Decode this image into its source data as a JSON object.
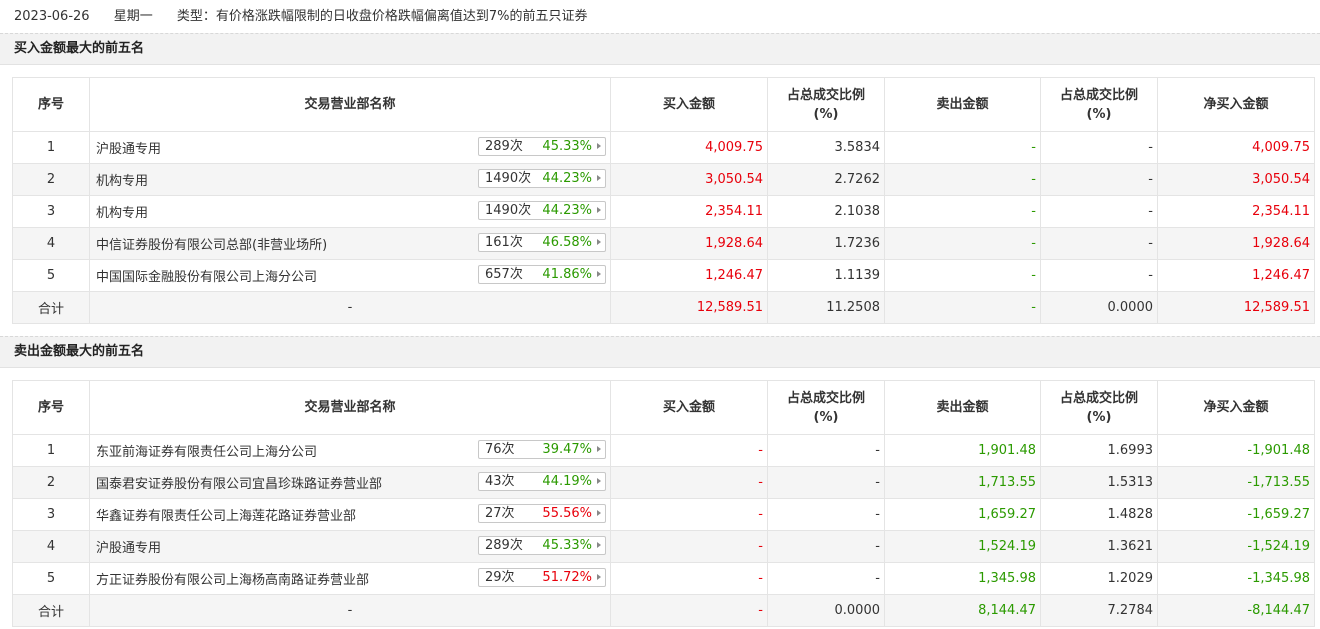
{
  "header": {
    "date": "2023-06-26",
    "weekday": "星期一",
    "type": "类型：有价格涨跌幅限制的日收盘价格跌幅偏离值达到7%的前五只证券"
  },
  "columns": {
    "seq": "序号",
    "branch": "交易营业部名称",
    "buy": "买入金额",
    "buy_ratio_l1": "占总成交比例",
    "buy_ratio_l2": "(%)",
    "sell": "卖出金额",
    "sell_ratio_l1": "占总成交比例",
    "sell_ratio_l2": "(%)",
    "net": "净买入金额"
  },
  "colors": {
    "up": "#e8000b",
    "down": "#2b9a00"
  },
  "buy_section": {
    "title": "买入金额最大的前五名",
    "rows": [
      {
        "seq": "1",
        "name": "沪股通专用",
        "count": "289次",
        "pct": "45.33%",
        "pct_color": "green",
        "buy": "4,009.75",
        "buy_ratio": "3.5834",
        "sell": "-",
        "sell_ratio": "-",
        "net": "4,009.75"
      },
      {
        "seq": "2",
        "name": "机构专用",
        "count": "1490次",
        "pct": "44.23%",
        "pct_color": "green",
        "buy": "3,050.54",
        "buy_ratio": "2.7262",
        "sell": "-",
        "sell_ratio": "-",
        "net": "3,050.54"
      },
      {
        "seq": "3",
        "name": "机构专用",
        "count": "1490次",
        "pct": "44.23%",
        "pct_color": "green",
        "buy": "2,354.11",
        "buy_ratio": "2.1038",
        "sell": "-",
        "sell_ratio": "-",
        "net": "2,354.11"
      },
      {
        "seq": "4",
        "name": "中信证券股份有限公司总部(非营业场所)",
        "count": "161次",
        "pct": "46.58%",
        "pct_color": "green",
        "buy": "1,928.64",
        "buy_ratio": "1.7236",
        "sell": "-",
        "sell_ratio": "-",
        "net": "1,928.64"
      },
      {
        "seq": "5",
        "name": "中国国际金融股份有限公司上海分公司",
        "count": "657次",
        "pct": "41.86%",
        "pct_color": "green",
        "buy": "1,246.47",
        "buy_ratio": "1.1139",
        "sell": "-",
        "sell_ratio": "-",
        "net": "1,246.47"
      }
    ],
    "total": {
      "label": "合计",
      "name": "-",
      "buy": "12,589.51",
      "buy_ratio": "11.2508",
      "sell": "-",
      "sell_ratio": "0.0000",
      "net": "12,589.51"
    }
  },
  "sell_section": {
    "title": "卖出金额最大的前五名",
    "rows": [
      {
        "seq": "1",
        "name": "东亚前海证券有限责任公司上海分公司",
        "count": "76次",
        "pct": "39.47%",
        "pct_color": "green",
        "buy": "-",
        "buy_ratio": "-",
        "sell": "1,901.48",
        "sell_ratio": "1.6993",
        "net": "-1,901.48"
      },
      {
        "seq": "2",
        "name": "国泰君安证券股份有限公司宜昌珍珠路证券营业部",
        "count": "43次",
        "pct": "44.19%",
        "pct_color": "green",
        "buy": "-",
        "buy_ratio": "-",
        "sell": "1,713.55",
        "sell_ratio": "1.5313",
        "net": "-1,713.55"
      },
      {
        "seq": "3",
        "name": "华鑫证券有限责任公司上海莲花路证券营业部",
        "count": "27次",
        "pct": "55.56%",
        "pct_color": "red",
        "buy": "-",
        "buy_ratio": "-",
        "sell": "1,659.27",
        "sell_ratio": "1.4828",
        "net": "-1,659.27"
      },
      {
        "seq": "4",
        "name": "沪股通专用",
        "count": "289次",
        "pct": "45.33%",
        "pct_color": "green",
        "buy": "-",
        "buy_ratio": "-",
        "sell": "1,524.19",
        "sell_ratio": "1.3621",
        "net": "-1,524.19"
      },
      {
        "seq": "5",
        "name": "方正证券股份有限公司上海杨高南路证券营业部",
        "count": "29次",
        "pct": "51.72%",
        "pct_color": "red",
        "buy": "-",
        "buy_ratio": "-",
        "sell": "1,345.98",
        "sell_ratio": "1.2029",
        "net": "-1,345.98"
      }
    ],
    "total": {
      "label": "合计",
      "name": "-",
      "buy": "-",
      "buy_ratio": "0.0000",
      "sell": "8,144.47",
      "sell_ratio": "7.2784",
      "net": "-8,144.47"
    }
  }
}
